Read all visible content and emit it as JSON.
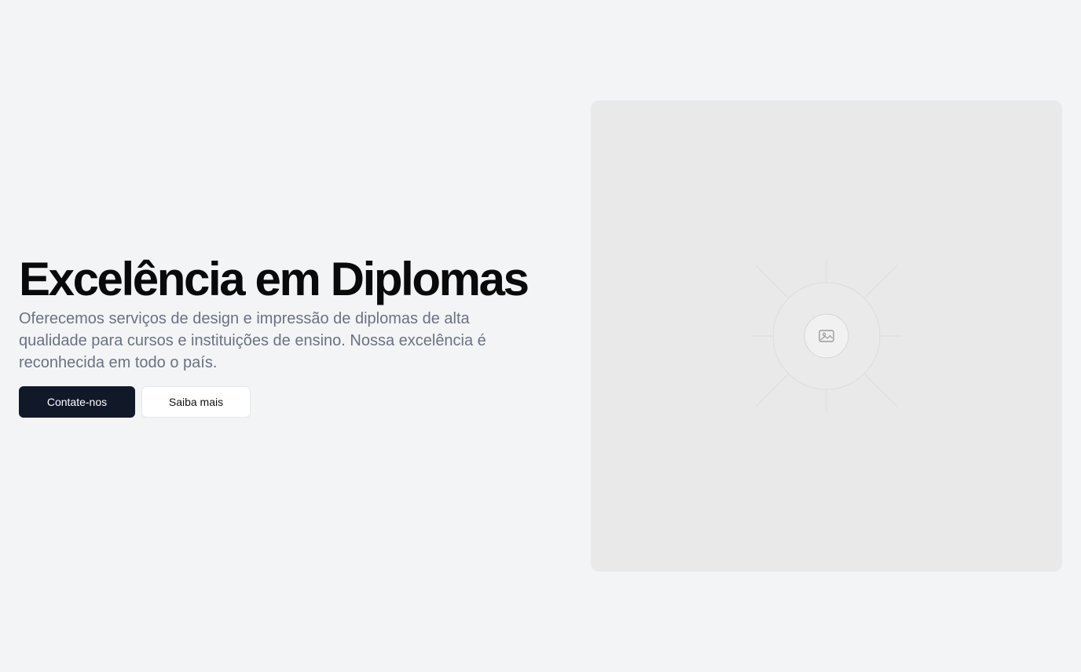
{
  "hero": {
    "title": "Excelência em Diplomas",
    "description": "Oferecemos serviços de design e impressão de diplomas de alta qualidade para cursos e instituições de ensino. Nossa excelência é reconhecida em todo o país.",
    "primary_button": "Contate-nos",
    "secondary_button": "Saiba mais"
  },
  "media": {
    "icon": "image-icon"
  },
  "colors": {
    "background": "#f2f4f6",
    "primary": "#111827",
    "text_muted": "#6b7280",
    "placeholder": "#e9e9e9"
  }
}
